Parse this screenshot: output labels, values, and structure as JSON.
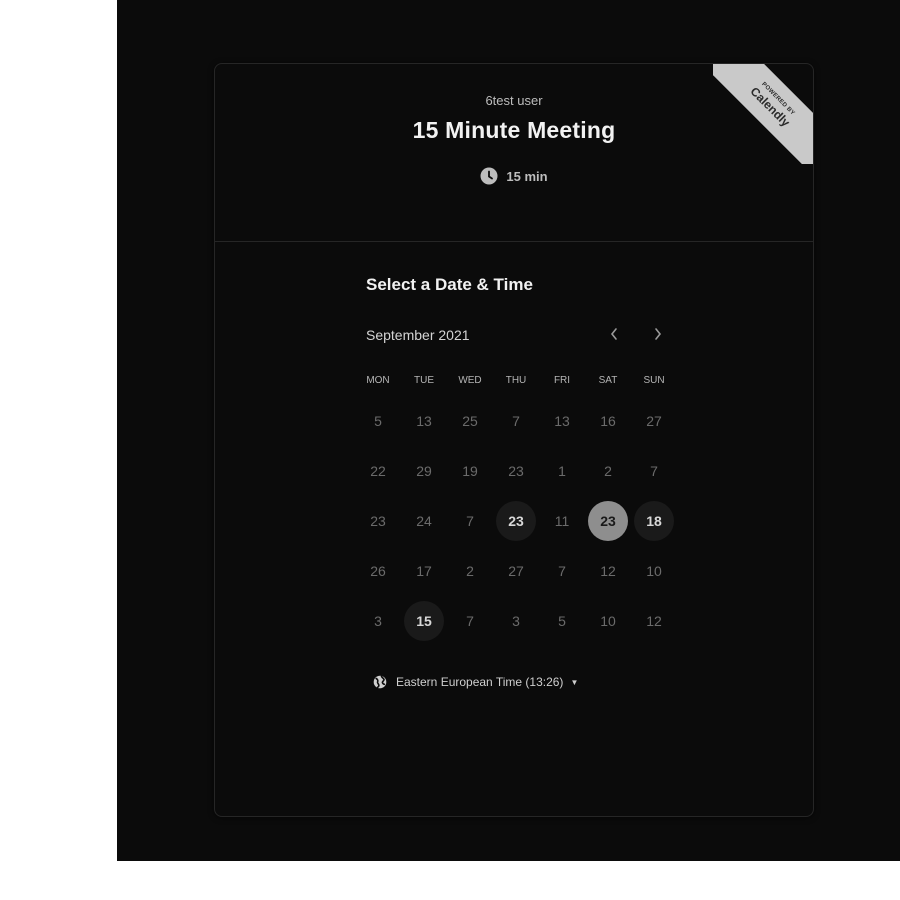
{
  "header": {
    "owner": "6test user",
    "title": "15 Minute Meeting",
    "duration": "15 min",
    "duration_icon": "clock-icon"
  },
  "badge": {
    "powered_by": "POWERED BY",
    "brand": "Calendly"
  },
  "scheduler": {
    "heading": "Select a Date & Time",
    "month_label": "September 2021",
    "prev_icon": "chevron-left-icon",
    "next_icon": "chevron-right-icon",
    "weekdays": [
      "MON",
      "TUE",
      "WED",
      "THU",
      "FRI",
      "SAT",
      "SUN"
    ],
    "weeks": [
      [
        {
          "d": "5"
        },
        {
          "d": "13"
        },
        {
          "d": "25"
        },
        {
          "d": "7"
        },
        {
          "d": "13"
        },
        {
          "d": "16"
        },
        {
          "d": "27"
        }
      ],
      [
        {
          "d": "22"
        },
        {
          "d": "29"
        },
        {
          "d": "19"
        },
        {
          "d": "23"
        },
        {
          "d": "1"
        },
        {
          "d": "2"
        },
        {
          "d": "7"
        }
      ],
      [
        {
          "d": "23"
        },
        {
          "d": "24"
        },
        {
          "d": "7"
        },
        {
          "d": "23",
          "state": "available"
        },
        {
          "d": "11"
        },
        {
          "d": "23",
          "state": "selected"
        },
        {
          "d": "18",
          "state": "available"
        }
      ],
      [
        {
          "d": "26"
        },
        {
          "d": "17"
        },
        {
          "d": "2"
        },
        {
          "d": "27"
        },
        {
          "d": "7"
        },
        {
          "d": "12"
        },
        {
          "d": "10"
        }
      ],
      [
        {
          "d": "3"
        },
        {
          "d": "15",
          "state": "available"
        },
        {
          "d": "7"
        },
        {
          "d": "3"
        },
        {
          "d": "5"
        },
        {
          "d": "10"
        },
        {
          "d": "12"
        }
      ]
    ],
    "timezone": {
      "label": "Eastern European Time (13:26)",
      "icon": "globe-icon"
    }
  },
  "colors": {
    "background": "#0b0b0b",
    "selected_day": "#8e8e8e",
    "available_day": "#1a1a1a",
    "ribbon": "#c9c9c9"
  }
}
